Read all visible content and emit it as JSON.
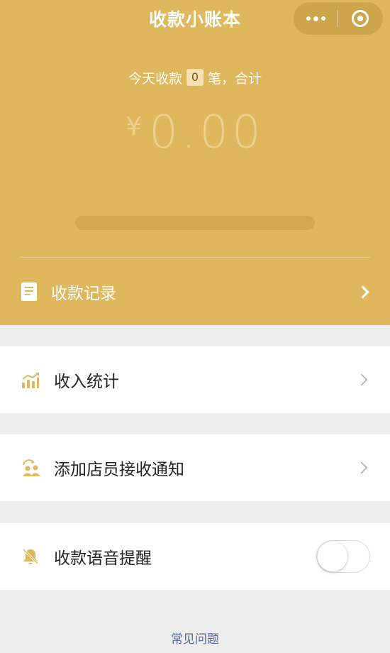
{
  "header": {
    "title": "收款小账本",
    "capsule": {
      "more_icon": "more-dots-icon",
      "close_icon": "target-close-icon"
    }
  },
  "summary": {
    "prefix": "今天收款",
    "count": "0",
    "suffix": "笔，合计",
    "currency": "¥",
    "amount": "0.00",
    "progress": 0
  },
  "records": {
    "label": "收款记录",
    "icon": "document-icon"
  },
  "menu": [
    {
      "label": "收入统计",
      "icon": "bar-chart-icon"
    },
    {
      "label": "添加店员接收通知",
      "icon": "add-staff-icon"
    },
    {
      "label": "收款语音提醒",
      "icon": "bell-mute-icon",
      "toggle_on": false
    }
  ],
  "footer": {
    "faq": "常见问题"
  },
  "colors": {
    "brand": "#dfb85e",
    "page_bg": "#ededed",
    "link": "#566c95"
  }
}
